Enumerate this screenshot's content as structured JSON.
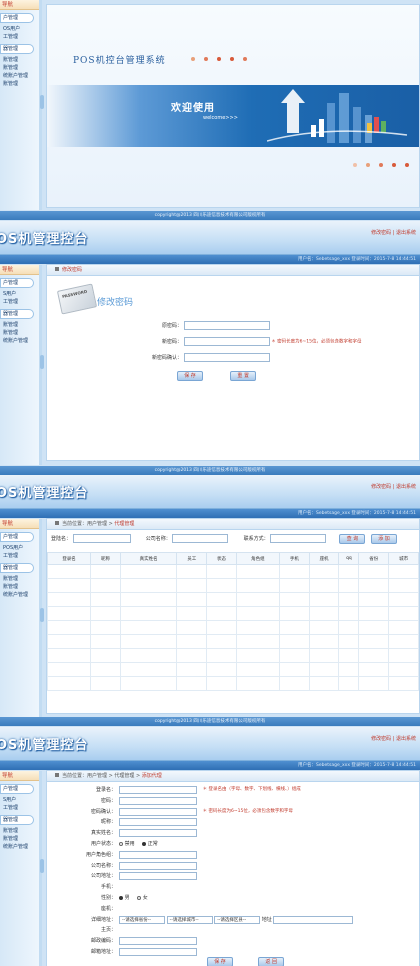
{
  "p1": {
    "side_title": "导航",
    "side_items": [
      "户管理",
      "OS用户",
      "工管理"
    ],
    "side_group": "器管理",
    "side_items2": [
      "账管理",
      "账管理",
      "统账户管理",
      "账管理"
    ],
    "brand": "POS机控台管理系统",
    "welcome": "欢迎使用",
    "welcome_en": "welcome>>>",
    "footer": "copyright@2013 四川乐途信息技术有限公司版权所有"
  },
  "header": {
    "logo": "OS机管理控台",
    "link1": "修改密码",
    "sep": "|",
    "link2": "退出系统",
    "userline": "用户名：Sebetsage_xxx 登录时间：2015-7-8 14:44:51"
  },
  "p2": {
    "side_title": "导航",
    "side_items": [
      "户管理",
      "S用户",
      "工管理"
    ],
    "side_group": "器管理",
    "side_items2": [
      "账管理",
      "账管理",
      "统账户管理"
    ],
    "bar_title": "修改密码",
    "heading": "修改密码",
    "card": "PASSWORD",
    "old_label": "原密码：",
    "new_label": "新密码：",
    "confirm_label": "新密码确认：",
    "hint": "＊ 密码长度为6~15位，必须包含数字和字母",
    "save": "保 存",
    "reset": "重 置",
    "footer": "copyright@2013 四川乐途信息技术有限公司版权所有"
  },
  "p3": {
    "side_title": "导航",
    "side_items": [
      "户管理",
      "POS用户",
      "工管理"
    ],
    "side_group": "器管理",
    "side_items2": [
      "账管理",
      "账管理",
      "统账户管理"
    ],
    "crumb_prefix": "当前位置：用户管理 > ",
    "crumb_current": "代理管理",
    "f_login": "登陆名：",
    "f_company": "公司名称：",
    "f_contact": "联系方式：",
    "search": "查 询",
    "add": "添 加",
    "columns": [
      "登录名",
      "昵称",
      "真实姓名",
      "员工",
      "状态",
      "角色组",
      "手机",
      "座机",
      "qq",
      "省份",
      "城市"
    ],
    "footer": "copyright@2013 四川乐途信息技术有限公司版权所有"
  },
  "p4": {
    "side_title": "导航",
    "side_items": [
      "户管理",
      "S用户",
      "工管理"
    ],
    "side_group": "器管理",
    "side_items2": [
      "账管理",
      "账管理",
      "统账户管理"
    ],
    "crumb_prefix": "当前位置：用户管理 > 代理管理 > ",
    "crumb_current": "添加代理",
    "rows": [
      {
        "label": "登录名：",
        "type": "input",
        "hint": "＊ 登录名由（字母、数字、下划线、横线、）组成"
      },
      {
        "label": "密码：",
        "type": "input",
        "hint": ""
      },
      {
        "label": "密码确认：",
        "type": "input",
        "hint": "＊ 密码长度为6~15位，必须包含数字和字母"
      },
      {
        "label": "昵称：",
        "type": "input",
        "hint": ""
      },
      {
        "label": "真实姓名：",
        "type": "input",
        "hint": ""
      },
      {
        "label": "用户状态：",
        "type": "radio",
        "hint": ""
      },
      {
        "label": "用户角色组：",
        "type": "input",
        "hint": ""
      },
      {
        "label": "公司名称：",
        "type": "input",
        "hint": ""
      },
      {
        "label": "公司地址：",
        "type": "input",
        "hint": ""
      },
      {
        "label": "手机：",
        "type": "text",
        "hint": ""
      },
      {
        "label": "性别：",
        "type": "gender",
        "hint": ""
      },
      {
        "label": "座机：",
        "type": "text",
        "hint": ""
      },
      {
        "label": "详细地址：",
        "type": "address",
        "hint": ""
      },
      {
        "label": "主页：",
        "type": "text",
        "hint": ""
      },
      {
        "label": "邮政编码：",
        "type": "input",
        "hint": ""
      },
      {
        "label": "邮箱地址：",
        "type": "input",
        "hint": ""
      }
    ],
    "status_opts": [
      "禁用",
      "正常"
    ],
    "gender_opts": [
      "男",
      "女"
    ],
    "province": "--请选择省份--",
    "city": "--请选择城市--",
    "district": "--请选择区县--",
    "addr_label": "地址",
    "save": "保 存",
    "back": "返 回"
  },
  "colors": {
    "accent": "#c0392b",
    "brand": "#1f6db5"
  }
}
